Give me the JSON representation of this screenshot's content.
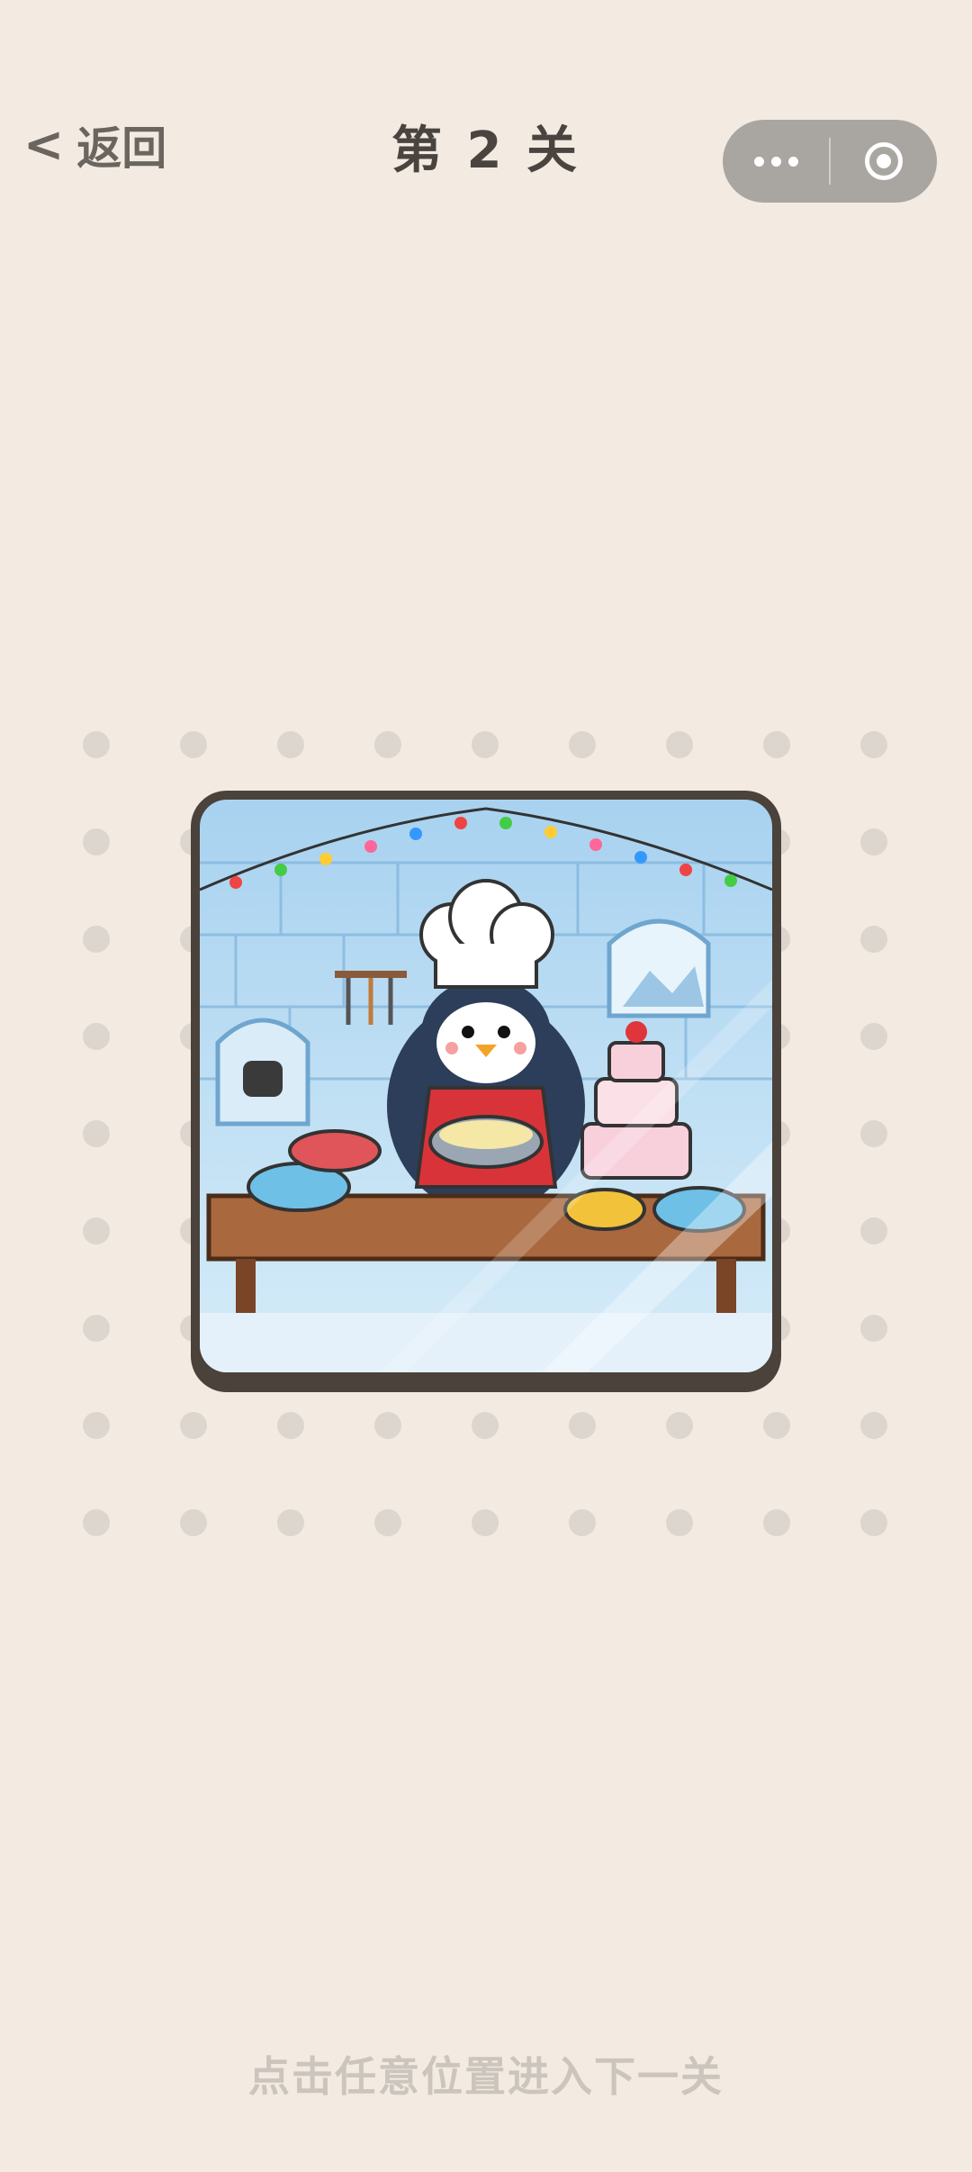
{
  "nav": {
    "back_label": "返回",
    "title": "第 2 关"
  },
  "capsule": {
    "more_icon": "more-dots-icon",
    "close_icon": "target-circle-icon"
  },
  "puzzle": {
    "scene": "penguin-chef-igloo-kitchen"
  },
  "footer": {
    "hint": "点击任意位置进入下一关"
  }
}
